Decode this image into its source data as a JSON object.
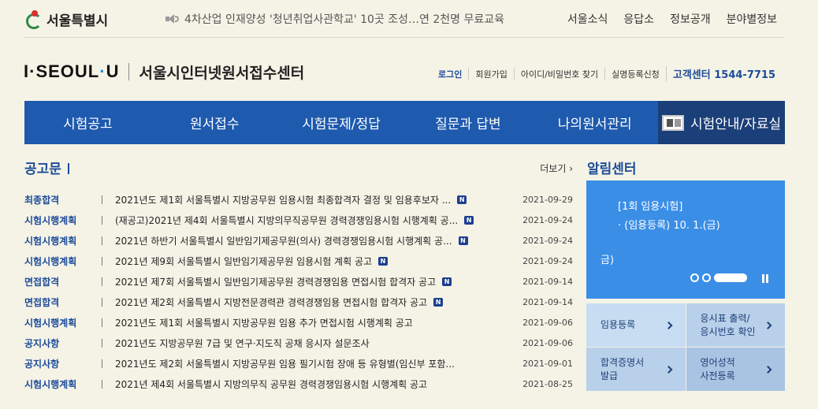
{
  "top": {
    "seoul_name": "서울특별시",
    "ticker": "4차산업 인재양성 '청년취업사관학교' 10곳 조성…연 2천명 무료교육",
    "links": [
      "서울소식",
      "응답소",
      "정보공개",
      "분야별정보"
    ]
  },
  "brand": {
    "logo_left": "I·",
    "logo_mid": "SEOUL",
    "logo_dot": "·",
    "logo_right": "U",
    "site_title": "서울시인터넷원서접수센터"
  },
  "util": {
    "login": "로그인",
    "join": "회원가입",
    "find": "아이디/비밀번호 찾기",
    "realname": "실명등록신청",
    "call_center": "고객센터 1544-7715"
  },
  "nav": [
    "시험공고",
    "원서접수",
    "시험문제/정답",
    "질문과 답변",
    "나의원서관리",
    "시험안내/자료실"
  ],
  "notice": {
    "title": "공고문",
    "more": "더보기",
    "rows": [
      {
        "cat": "최종합격",
        "title": "2021년도 제1회 서울특별시 지방공무원 임용시험 최종합격자 결정 및 임용후보자 ...",
        "new": true,
        "date": "2021-09-29"
      },
      {
        "cat": "시험시행계획",
        "title": "(재공고)2021년 제4회 서울특별시 지방의무직공무원 경력경쟁임용시험 시행계획 공...",
        "new": true,
        "date": "2021-09-24"
      },
      {
        "cat": "시험시행계획",
        "title": "2021년 하반기 서울특별시 일반임기제공무원(의사) 경력경쟁임용시험 시행계획 공...",
        "new": true,
        "date": "2021-09-24"
      },
      {
        "cat": "시험시행계획",
        "title": "2021년 제9회 서울특별시 일반임기제공무원 임용시험 계획 공고",
        "new": true,
        "date": "2021-09-24"
      },
      {
        "cat": "면접합격",
        "title": "2021년 제7회 서울특별시 일반임기제공무원 경력경쟁임용 면접시험 합격자 공고",
        "new": true,
        "date": "2021-09-14"
      },
      {
        "cat": "면접합격",
        "title": "2021년 제2회 서울특별시 지방전문경력관 경력경쟁임용 면접시험 합격자 공고",
        "new": true,
        "date": "2021-09-14"
      },
      {
        "cat": "시험시행계획",
        "title": "2021년도 제1회 서울특별시 지방공무원 임용 추가 면접시험 시행계획 공고",
        "new": false,
        "date": "2021-09-06"
      },
      {
        "cat": "공지사항",
        "title": "2021년도 지방공무원 7급 및 연구·지도직 공채 응시자 설문조사",
        "new": false,
        "date": "2021-09-06"
      },
      {
        "cat": "공지사항",
        "title": "2021년도 제2회 서울특별시 지방공무원 임용 필기시험 장애 등 유형별(임신부 포함...",
        "new": false,
        "date": "2021-09-01"
      },
      {
        "cat": "시험시행계획",
        "title": "2021년 제4회 서울특별시 지방의무직 공무원 경력경쟁임용시험 시행계획 공고",
        "new": false,
        "date": "2021-08-25"
      }
    ],
    "new_label": "N"
  },
  "alert": {
    "title": "알림센터",
    "line1": "[1회 임용시험]",
    "line2": "· (임용등록) 10. 1.(금)",
    "line3": "금)"
  },
  "quick": [
    {
      "label": "임용등록"
    },
    {
      "label": "응시표 출력/\n응시번호 확인"
    },
    {
      "label": "합격증명서\n발급"
    },
    {
      "label": "영어성적\n사전등록"
    }
  ],
  "colors": {
    "nav": "#1e5aae",
    "nav_active": "#1b3f78",
    "alert_bg": "#3b8ee6",
    "background": "#f5f3e6"
  }
}
